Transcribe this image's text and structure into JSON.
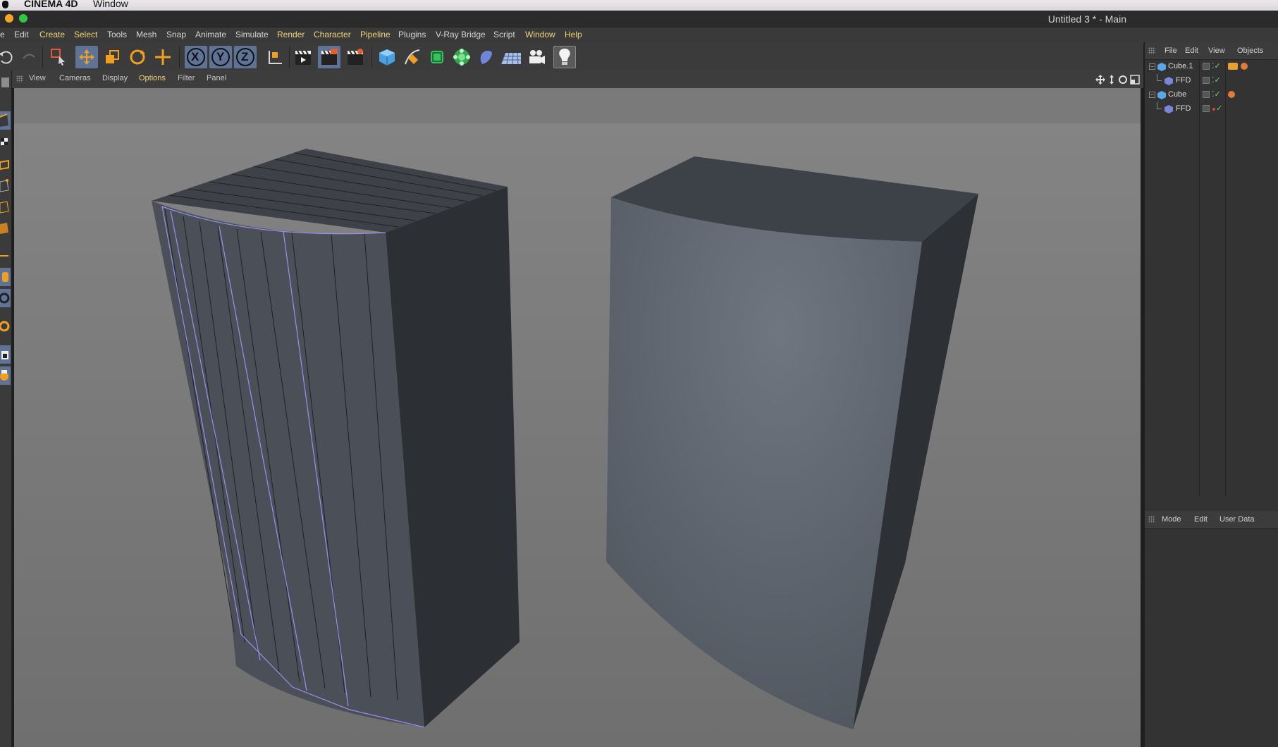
{
  "mac_menu": {
    "app": "CINEMA 4D",
    "item": "Window"
  },
  "window": {
    "title": "Untitled 3 * - Main"
  },
  "menu": [
    {
      "label": "e",
      "hl": false
    },
    {
      "label": "Edit",
      "hl": false
    },
    {
      "label": "Create",
      "hl": true
    },
    {
      "label": "Select",
      "hl": true
    },
    {
      "label": "Tools",
      "hl": false
    },
    {
      "label": "Mesh",
      "hl": false
    },
    {
      "label": "Snap",
      "hl": false
    },
    {
      "label": "Animate",
      "hl": false
    },
    {
      "label": "Simulate",
      "hl": false
    },
    {
      "label": "Render",
      "hl": true
    },
    {
      "label": "Character",
      "hl": true
    },
    {
      "label": "Pipeline",
      "hl": true
    },
    {
      "label": "Plugins",
      "hl": false
    },
    {
      "label": "V-Ray Bridge",
      "hl": false
    },
    {
      "label": "Script",
      "hl": false
    },
    {
      "label": "Window",
      "hl": true
    },
    {
      "label": "Help",
      "hl": true
    }
  ],
  "toolbar": {
    "axis_x": "X",
    "axis_y": "Y",
    "axis_z": "Z"
  },
  "viewport_menu": [
    "View",
    "Cameras",
    "Display",
    "Options",
    "Filter",
    "Panel"
  ],
  "object_manager": {
    "menu": [
      "File",
      "Edit",
      "View",
      "Objects"
    ],
    "objects": [
      {
        "name": "Cube.1",
        "depth": 0
      },
      {
        "name": "FFD",
        "depth": 1
      },
      {
        "name": "Cube",
        "depth": 0
      },
      {
        "name": "FFD",
        "depth": 1
      }
    ]
  },
  "attribute_manager": {
    "menu": [
      "Mode",
      "Edit",
      "User Data"
    ]
  },
  "colors": {
    "accent": "#f1d37a",
    "active_tool": "#5f7396",
    "viewport_bg": "#7b7b7b",
    "selection_edge": "#9b8ef0"
  }
}
